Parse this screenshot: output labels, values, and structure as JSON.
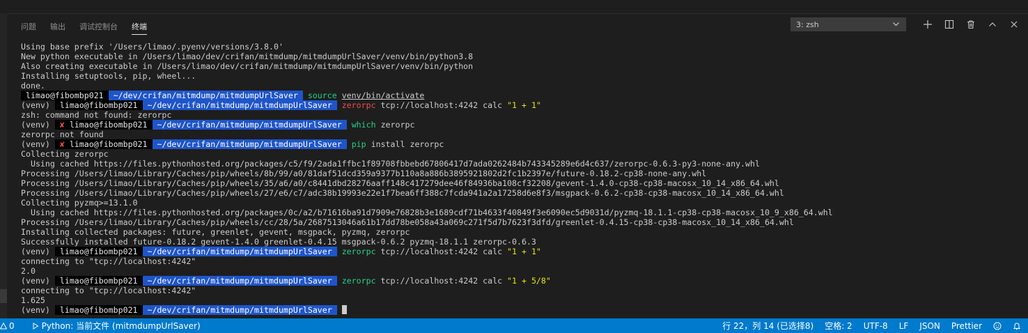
{
  "panel": {
    "tabs": [
      "问题",
      "输出",
      "调试控制台",
      "终端"
    ],
    "active_tab": 3,
    "terminal_selector": "3: zsh",
    "actions": [
      "add-icon",
      "split-icon",
      "trash-icon",
      "chevron-up-icon",
      "close-icon"
    ]
  },
  "terminal": {
    "lines": [
      [
        {
          "t": "Using base prefix '/Users/limao/.pyenv/versions/3.8.0'"
        }
      ],
      [
        {
          "t": "New python executable in /Users/limao/dev/crifan/mitmdump/mitmdumpUrlSaver/venv/bin/python3.8"
        }
      ],
      [
        {
          "t": "Also creating executable in /Users/limao/dev/crifan/mitmdump/mitmdumpUrlSaver/venv/bin/python"
        }
      ],
      [
        {
          "t": "Installing setuptools, pip, wheel..."
        }
      ],
      [
        {
          "t": "done."
        }
      ],
      [
        {
          "t": " limao@fibombp021 ",
          "c": "seg-user"
        },
        {
          "t": " ~/dev/crifan/mitmdump/mitmdumpUrlSaver ",
          "c": "seg-path"
        },
        {
          "t": " "
        },
        {
          "t": "source",
          "c": "g"
        },
        {
          "t": " "
        },
        {
          "t": "venv/bin/activate",
          "c": "u"
        }
      ],
      [
        {
          "t": "(venv) "
        },
        {
          "t": " limao@fibombp021 ",
          "c": "seg-user"
        },
        {
          "t": " ~/dev/crifan/mitmdump/mitmdumpUrlSaver ",
          "c": "seg-path"
        },
        {
          "t": " "
        },
        {
          "t": "zerorpc",
          "c": "r"
        },
        {
          "t": " tcp://localhost:4242 calc "
        },
        {
          "t": "\"1 + 1\"",
          "c": "y"
        }
      ],
      [
        {
          "t": "zsh: command not found: zerorpc"
        }
      ],
      [
        {
          "t": "(venv) "
        },
        {
          "t": " ✘ ",
          "c": "cross"
        },
        {
          "t": "limao@fibombp021 ",
          "c": "seg-user"
        },
        {
          "t": " ~/dev/crifan/mitmdump/mitmdumpUrlSaver ",
          "c": "seg-path"
        },
        {
          "t": " "
        },
        {
          "t": "which",
          "c": "g"
        },
        {
          "t": " zerorpc"
        }
      ],
      [
        {
          "t": "zerorpc not found"
        }
      ],
      [
        {
          "t": "(venv) "
        },
        {
          "t": " ✘ ",
          "c": "cross"
        },
        {
          "t": "limao@fibombp021 ",
          "c": "seg-user"
        },
        {
          "t": " ~/dev/crifan/mitmdump/mitmdumpUrlSaver ",
          "c": "seg-path"
        },
        {
          "t": " "
        },
        {
          "t": "pip",
          "c": "g"
        },
        {
          "t": " install zerorpc"
        }
      ],
      [
        {
          "t": "Collecting zerorpc"
        }
      ],
      [
        {
          "t": "  Using cached https://files.pythonhosted.org/packages/c5/f9/2ada1ffbc1f89708fbbebd67806417d7ada0262484b743345289e6d4c637/zerorpc-0.6.3-py3-none-any.whl"
        }
      ],
      [
        {
          "t": "Processing /Users/limao/Library/Caches/pip/wheels/8b/99/a0/81daf51dcd359a9377b110a8a886b3895921802d2fc1b2397e/future-0.18.2-cp38-none-any.whl"
        }
      ],
      [
        {
          "t": "Processing /Users/limao/Library/Caches/pip/wheels/35/a6/a0/c8441dbd28276aaff148c417279dee46f84936ba108cf32208/gevent-1.4.0-cp38-cp38-macosx_10_14_x86_64.whl"
        }
      ],
      [
        {
          "t": "Processing /Users/limao/Library/Caches/pip/wheels/27/e6/c7/adc38b19993e22e1f7bea6ff388c7fcda941a2a17258d6e8f3/msgpack-0.6.2-cp38-cp38-macosx_10_14_x86_64.whl"
        }
      ],
      [
        {
          "t": "Collecting pyzmq>=13.1.0"
        }
      ],
      [
        {
          "t": "  Using cached https://files.pythonhosted.org/packages/0c/a2/b71616ba91d7909e76828b3e1689cdf71b4633f40849f3e6090ec5d9031d/pyzmq-18.1.1-cp38-cp38-macosx_10_9_x86_64.whl"
        }
      ],
      [
        {
          "t": "Processing /Users/limao/Library/Caches/pip/wheels/cc/28/5a/2687513046a61b17dd78be058a43a069c271f5d7b7623f3dfd/greenlet-0.4.15-cp38-cp38-macosx_10_14_x86_64.whl"
        }
      ],
      [
        {
          "t": "Installing collected packages: future, greenlet, gevent, msgpack, pyzmq, zerorpc"
        }
      ],
      [
        {
          "t": "Successfully installed future-0.18.2 gevent-1.4.0 greenlet-0.4.15 msgpack-0.6.2 pyzmq-18.1.1 zerorpc-0.6.3"
        }
      ],
      [
        {
          "t": "(venv) "
        },
        {
          "t": " limao@fibombp021 ",
          "c": "seg-user"
        },
        {
          "t": " ~/dev/crifan/mitmdump/mitmdumpUrlSaver ",
          "c": "seg-path"
        },
        {
          "t": " "
        },
        {
          "t": "zerorpc",
          "c": "g"
        },
        {
          "t": " tcp://localhost:4242 calc "
        },
        {
          "t": "\"1 + 1\"",
          "c": "y"
        }
      ],
      [
        {
          "t": "connecting to \"tcp://localhost:4242\""
        }
      ],
      [
        {
          "t": "2.0"
        }
      ],
      [
        {
          "t": "(venv) "
        },
        {
          "t": " limao@fibombp021 ",
          "c": "seg-user"
        },
        {
          "t": " ~/dev/crifan/mitmdump/mitmdumpUrlSaver ",
          "c": "seg-path"
        },
        {
          "t": " "
        },
        {
          "t": "zerorpc",
          "c": "g"
        },
        {
          "t": " tcp://localhost:4242 calc "
        },
        {
          "t": "\"1 + 5/8\"",
          "c": "y"
        }
      ],
      [
        {
          "t": "connecting to \"tcp://localhost:4242\""
        }
      ],
      [
        {
          "t": "1.625"
        }
      ],
      [
        {
          "t": "(venv) "
        },
        {
          "t": " limao@fibombp021 ",
          "c": "seg-user"
        },
        {
          "t": " ~/dev/crifan/mitmdump/mitmdumpUrlSaver ",
          "c": "seg-path"
        },
        {
          "t": " "
        },
        {
          "cursor": true
        }
      ]
    ]
  },
  "statusbar": {
    "left": {
      "alerts": "0",
      "interpreter": "Python: 当前文件 (mitmdumpUrlSaver)"
    },
    "right": [
      "行 22，列 14 (已选择8)",
      "空格: 2",
      "UTF-8",
      "LF",
      "JSON",
      "Prettier"
    ]
  },
  "colors": {
    "statusbar": "#007acc",
    "path_segment": "#1f55c9",
    "accent_green": "#23d18b",
    "error_red": "#f14c4c",
    "string_yellow": "#e5e510"
  }
}
